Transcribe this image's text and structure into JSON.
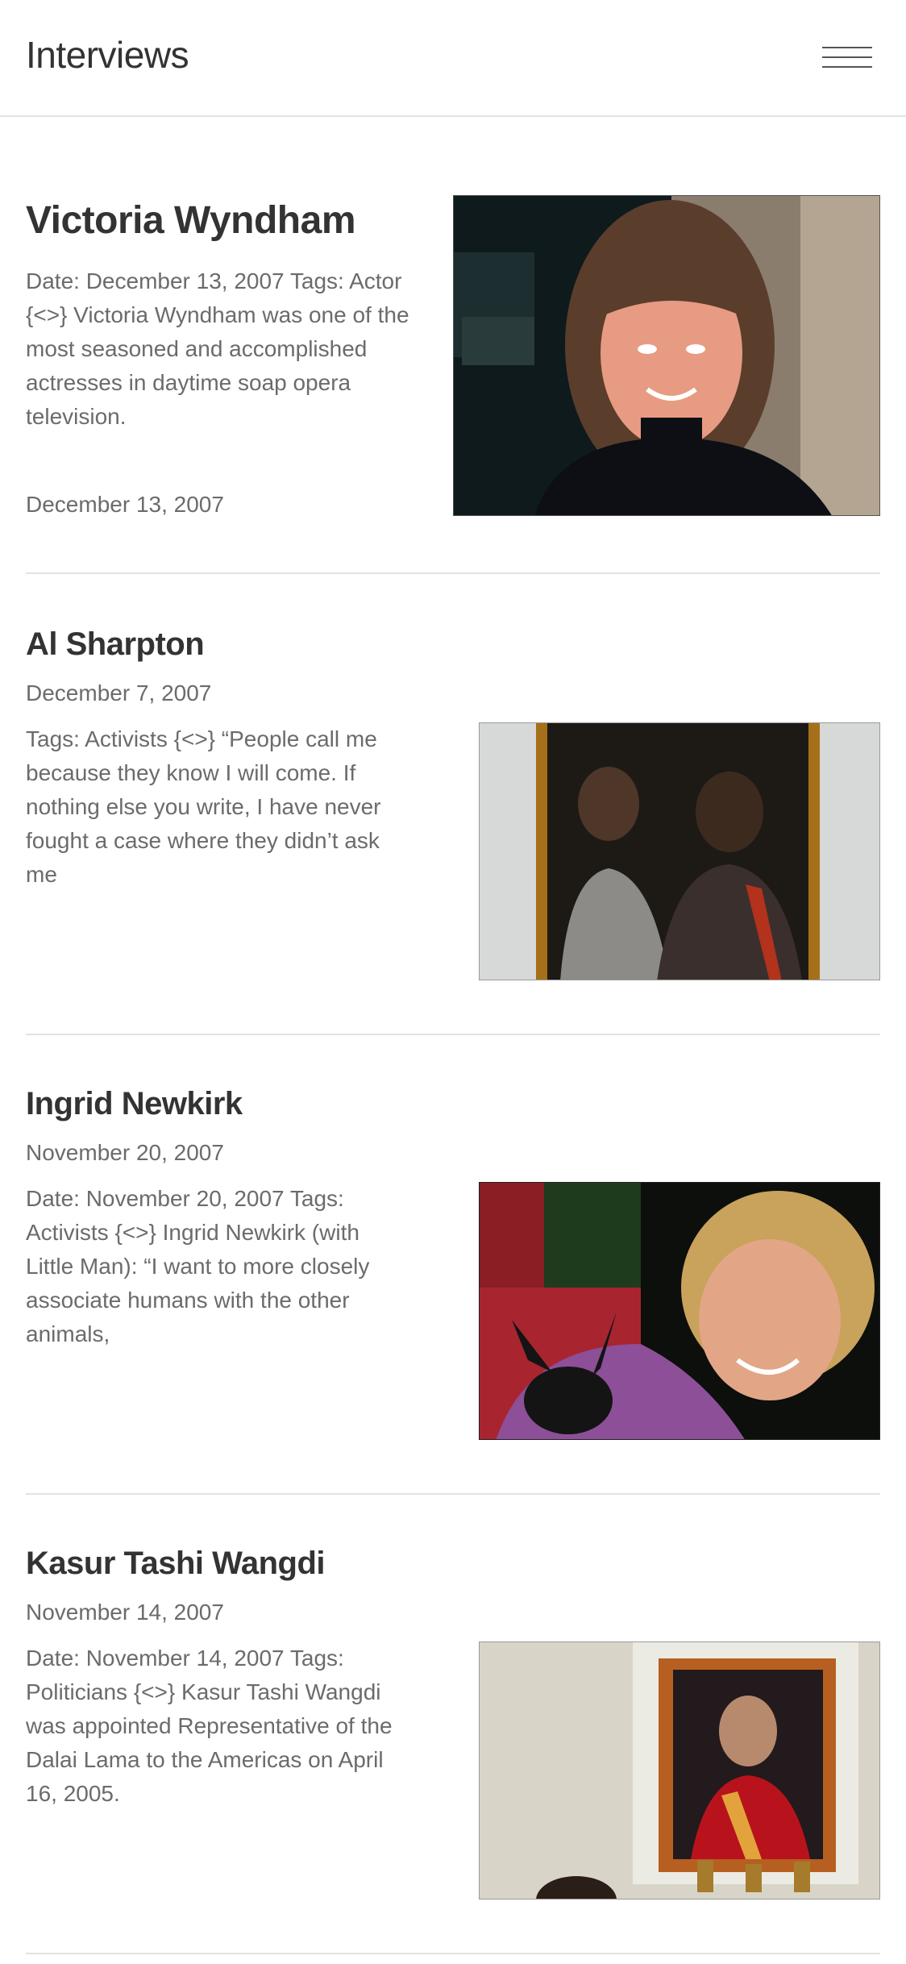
{
  "header": {
    "title": "Interviews",
    "menu_icon": "hamburger-menu-icon"
  },
  "articles": [
    {
      "title": "Victoria Wyndham",
      "excerpt": "Date: December 13, 2007 Tags: Actor {<>} Victoria Wyndham was one of the most seasoned and accomplished actresses in daytime soap opera television.",
      "date": "December 13, 2007"
    },
    {
      "title": "Al Sharpton",
      "date": "December 7, 2007",
      "excerpt": "Tags: Activists {<>} “People call me because they know I will come. If nothing else you write, I have never fought a case where they didn’t ask me"
    },
    {
      "title": "Ingrid Newkirk",
      "date": "November 20, 2007",
      "excerpt": "Date: November 20, 2007 Tags: Activists {<>} Ingrid Newkirk (with Little Man): “I want to more closely associate humans with the other animals,"
    },
    {
      "title": "Kasur Tashi Wangdi",
      "date": "November 14, 2007",
      "excerpt": "Date: November 14, 2007 Tags: Politicians {<>} Kasur Tashi Wangdi was appointed Representative of the Dalai Lama to the Americas on April 16, 2005."
    }
  ],
  "colors": {
    "text_dark": "#333333",
    "text_muted": "#6b6b6b",
    "divider": "#e2e2e2"
  }
}
